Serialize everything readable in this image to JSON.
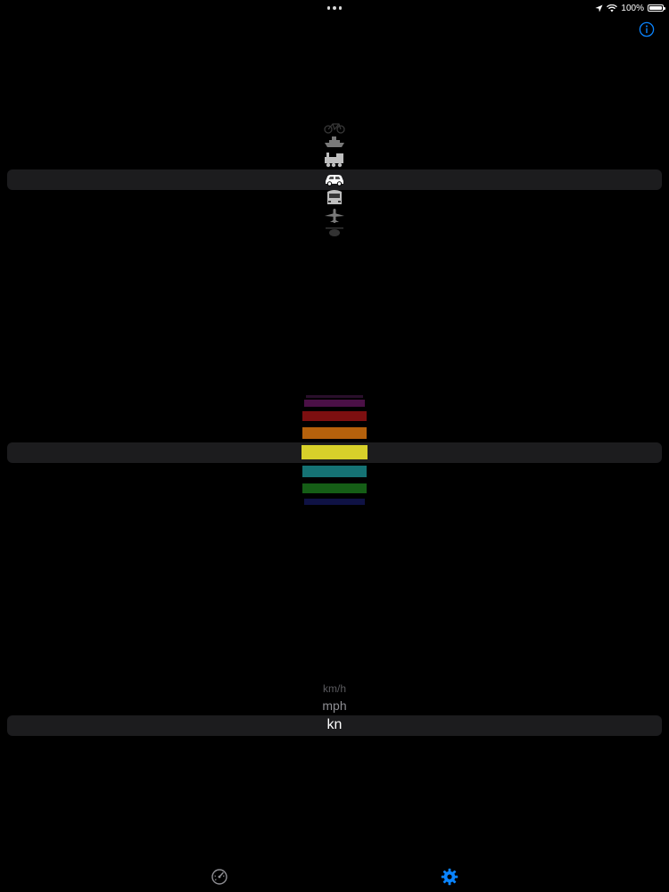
{
  "status_bar": {
    "battery_percent": "100%",
    "icons": [
      "location-arrow-icon",
      "wifi-icon",
      "battery-icon"
    ]
  },
  "header": {
    "info_icon": "info-icon",
    "accent_color": "#0a84ff"
  },
  "vehicle_picker": {
    "items": [
      "bicycle-icon",
      "boat-icon",
      "train-icon",
      "car-icon",
      "high-speed-train-icon",
      "airplane-icon"
    ],
    "selected": "car-icon"
  },
  "color_picker": {
    "swatches": [
      "#2a0f2c",
      "#4b1046",
      "#7d0f10",
      "#b5610c",
      "#d7d02a",
      "#157274",
      "#155e16",
      "#0f1244"
    ],
    "selected": "#d7d02a"
  },
  "unit_picker": {
    "items": [
      "km/h",
      "mph",
      "kn"
    ],
    "selected": "kn"
  },
  "tab_bar": {
    "tabs": [
      {
        "icon": "speedometer-icon",
        "active": false
      },
      {
        "icon": "gear-icon",
        "active": true
      }
    ],
    "active_color": "#0a84ff",
    "inactive_color": "#8e8e93"
  }
}
